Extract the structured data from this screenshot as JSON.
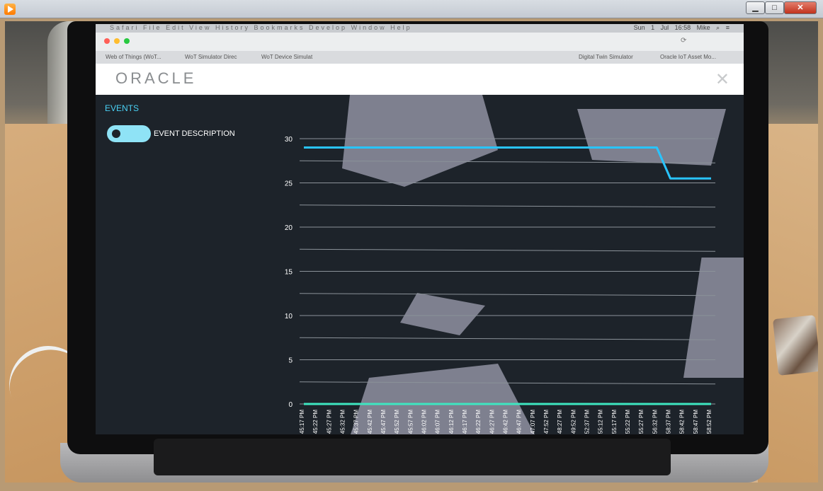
{
  "player": {
    "window_buttons": {
      "minimize": "▁",
      "maximize": "□",
      "close": "✕"
    }
  },
  "mac_menubar": {
    "app": "Safari",
    "menus": [
      "File",
      "Edit",
      "View",
      "History",
      "Bookmarks",
      "Develop",
      "Window",
      "Help"
    ],
    "clock": "Sun 1 Jul 16:58",
    "user": "Mike"
  },
  "browser": {
    "tabs": [
      "Web of Things (WoT...",
      "WoT Simulator Direc",
      "WoT Device Simulat",
      "",
      "Digital Twin Simulator",
      "Oracle IoT Asset Mo..."
    ]
  },
  "page": {
    "logo": "ORACLE",
    "close_icon": "close-icon",
    "events_title": "EVENTS",
    "toggle_label": "EVENT DESCRIPTION",
    "accent": "#4ad1f5"
  },
  "chart_data": {
    "type": "line",
    "y_ticks": [
      "30",
      "25",
      "20",
      "15",
      "10",
      "5",
      "0"
    ],
    "ylim": [
      0,
      30
    ],
    "grid": true,
    "categories": [
      "45:17 PM",
      "45:22 PM",
      "45:27 PM",
      "45:32 PM",
      "45:37 PM",
      "45:42 PM",
      "45:47 PM",
      "45:52 PM",
      "45:57 PM",
      "46:02 PM",
      "46:07 PM",
      "46:12 PM",
      "46:17 PM",
      "46:22 PM",
      "46:27 PM",
      "46:42 PM",
      "46:47 PM",
      "47:07 PM",
      "47:52 PM",
      "48:27 PM",
      "49:52 PM",
      "52:37 PM",
      "55:12 PM",
      "55:17 PM",
      "55:22 PM",
      "55:27 PM",
      "56:32 PM",
      "58:37 PM",
      "58:42 PM",
      "58:47 PM",
      "58:52 PM"
    ],
    "series": [
      {
        "color": "#29c4ff",
        "values": [
          29,
          29,
          29,
          29,
          29,
          29,
          29,
          29,
          29,
          29,
          29,
          29,
          29,
          29,
          29,
          29,
          29,
          29,
          29,
          29,
          29,
          29,
          29,
          29,
          29,
          29,
          29,
          25.5,
          25.5,
          25.5,
          25.5
        ]
      },
      {
        "color": "#3ee6c0",
        "values": [
          0,
          0,
          0,
          0,
          0,
          0,
          0,
          0,
          0,
          0,
          0,
          0,
          0,
          0,
          0,
          0,
          0,
          0,
          0,
          0,
          0,
          0,
          0,
          0,
          0,
          0,
          0,
          0,
          0,
          0,
          0
        ]
      }
    ]
  }
}
